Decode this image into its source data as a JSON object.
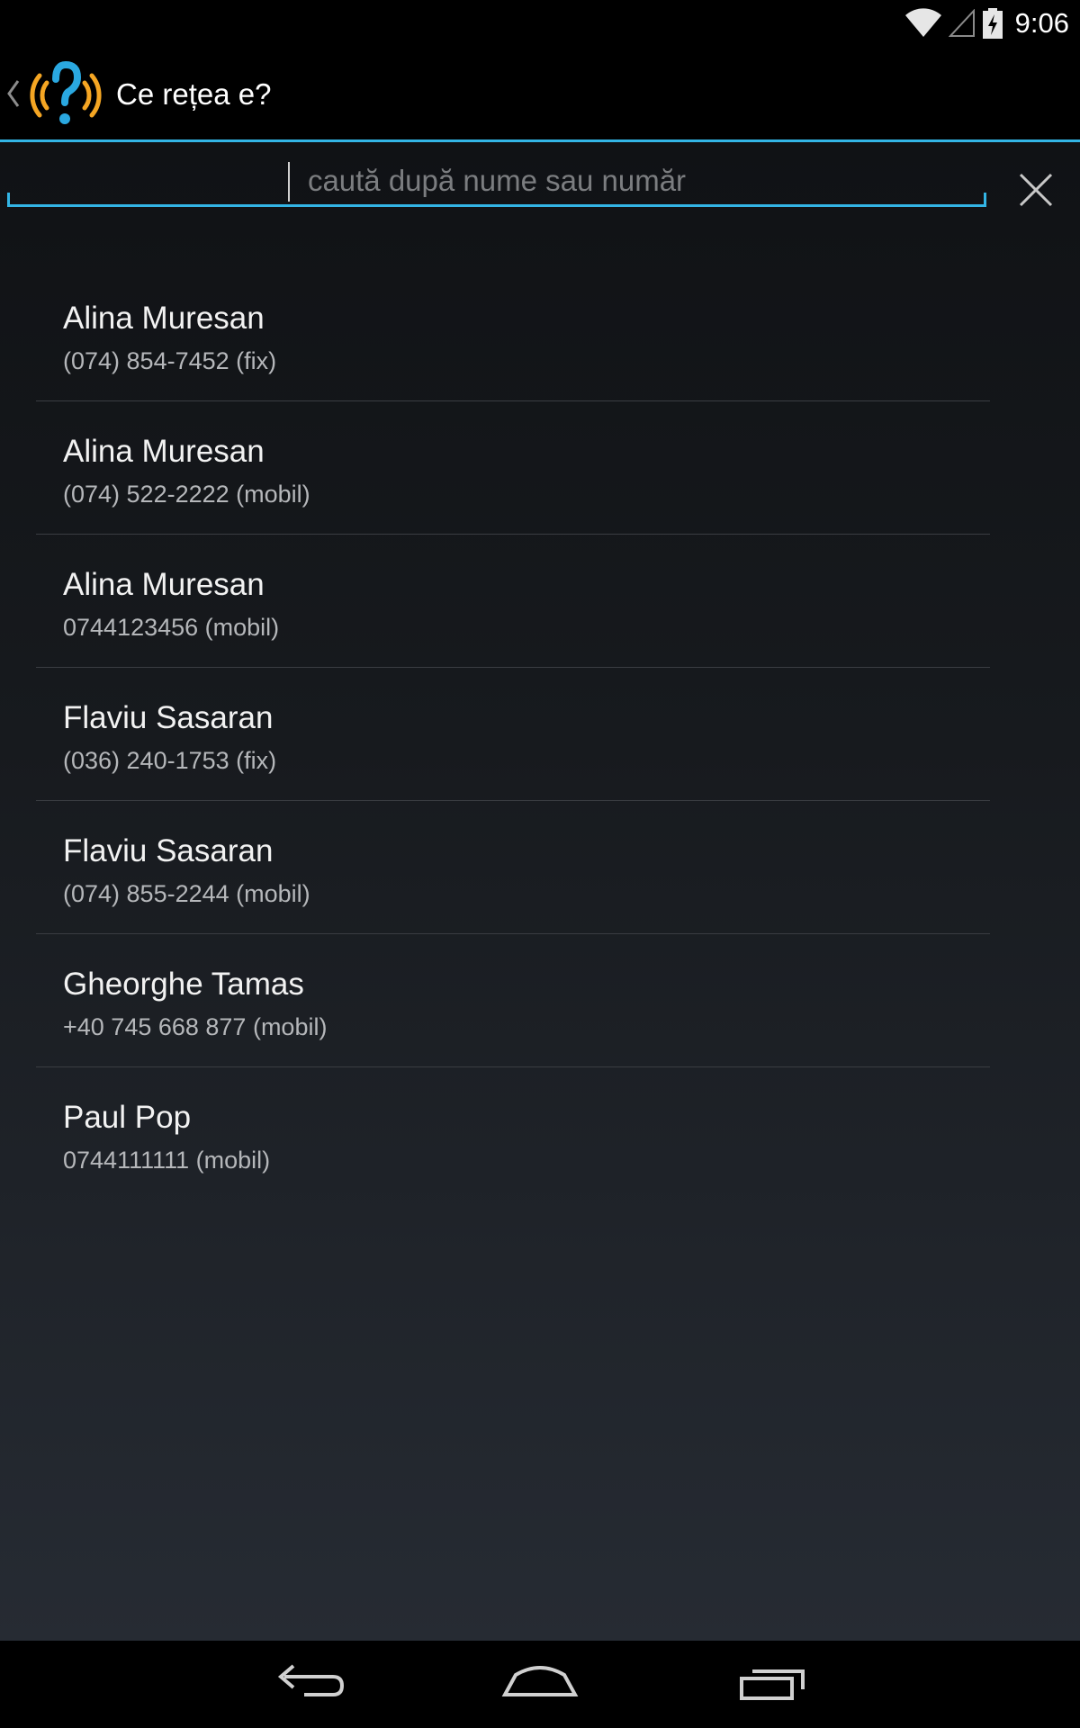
{
  "status_bar": {
    "time": "9:06"
  },
  "action_bar": {
    "title": "Ce rețea e?"
  },
  "search": {
    "placeholder": "caută după nume sau număr",
    "value": ""
  },
  "contacts": [
    {
      "name": "Alina Muresan",
      "number": "(074) 854-7452 (fix)"
    },
    {
      "name": "Alina Muresan",
      "number": "(074) 522-2222 (mobil)"
    },
    {
      "name": "Alina Muresan",
      "number": "0744123456 (mobil)"
    },
    {
      "name": "Flaviu Sasaran",
      "number": "(036) 240-1753 (fix)"
    },
    {
      "name": "Flaviu Sasaran",
      "number": "(074) 855-2244 (mobil)"
    },
    {
      "name": "Gheorghe Tamas",
      "number": "+40 745 668 877 (mobil)"
    },
    {
      "name": "Paul Pop",
      "number": "0744111111 (mobil)"
    }
  ],
  "colors": {
    "accent": "#33b5e5",
    "icon_orange": "#f5a623",
    "icon_blue": "#2aa8e0"
  }
}
